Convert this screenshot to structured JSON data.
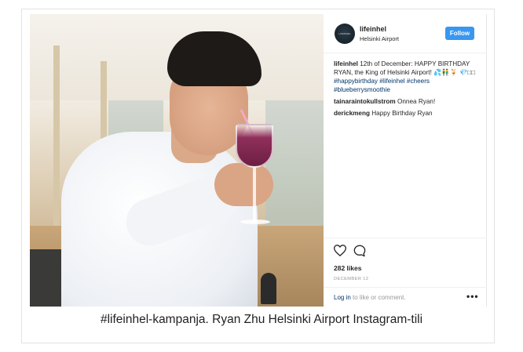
{
  "post": {
    "avatar_text": "LIFEINHEL",
    "username": "lifeinhel",
    "location": "Helsinki Airport",
    "follow_label": "Follow",
    "caption_user": "lifeinhel",
    "caption_text": " 12th of December: HAPPY BIRTHDAY RYAN, the King of Helsinki Airport! 💦👬🍹 💎□□ ",
    "hashtags": [
      "#happybirthday",
      "#lifeinhel",
      "#cheers",
      "#blueberrysmoothie"
    ],
    "comments": [
      {
        "user": "tainaraintokullstrom",
        "text": "Onnea Ryan!"
      },
      {
        "user": "derickmeng",
        "text": "Happy Birthday Ryan"
      }
    ],
    "likes": "282 likes",
    "date": "DECEMBER 12",
    "login_link": "Log in",
    "login_text": " to like or comment.",
    "more": "•••",
    "icons": {
      "like": "heart-icon",
      "comment": "comment-icon"
    }
  },
  "figure_caption": "#lifeinhel-kampanja. Ryan Zhu Helsinki Airport Instagram-tili"
}
